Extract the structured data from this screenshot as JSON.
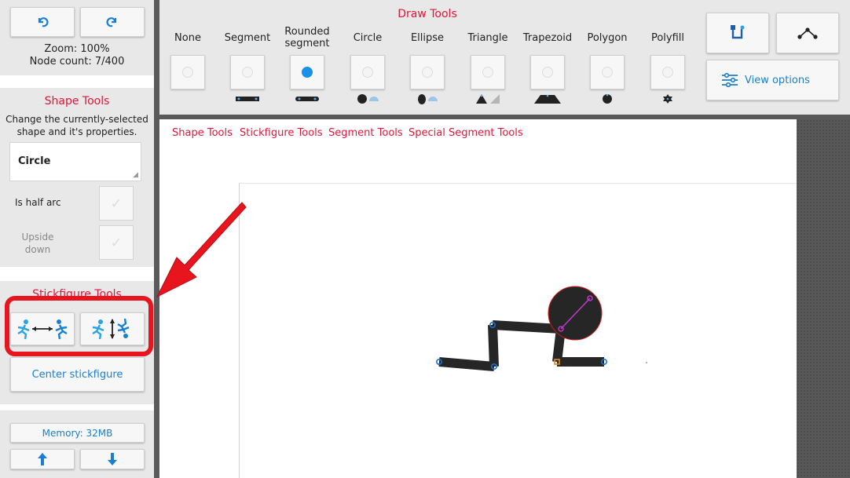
{
  "sidebar": {
    "zoom": "Zoom: 100%",
    "node_count": "Node count: 7/400",
    "shape_tools": {
      "title": "Shape Tools",
      "description": "Change the currently-selected shape and it's properties.",
      "selected_shape": "Circle",
      "half_arc_label": "Is half arc",
      "upside_down_label": "Upside down"
    },
    "stickfigure_tools": {
      "title": "Stickfigure Tools",
      "center_label": "Center stickfigure"
    },
    "memory": "Memory: 32MB"
  },
  "draw_tools": {
    "title": "Draw Tools",
    "tools": [
      {
        "label": "None"
      },
      {
        "label": "Segment"
      },
      {
        "label": "Rounded segment"
      },
      {
        "label": "Circle"
      },
      {
        "label": "Ellipse"
      },
      {
        "label": "Triangle"
      },
      {
        "label": "Trapezoid"
      },
      {
        "label": "Polygon"
      },
      {
        "label": "Polyfill"
      }
    ],
    "selected_index": 2,
    "view_options_label": "View options"
  },
  "canvas": {
    "tabs": [
      "Shape Tools",
      "Stickfigure Tools",
      "Segment Tools",
      "Special Segment Tools"
    ]
  },
  "colors": {
    "accent_red": "#e0173a",
    "accent_blue": "#1a7fd0",
    "highlight_red": "#e8141e"
  }
}
